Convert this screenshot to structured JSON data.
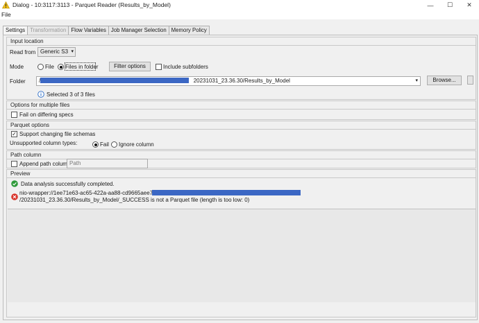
{
  "window": {
    "title": "Dialog - 10:3117:3113 - Parquet Reader (Results_by_Model)",
    "minimize": "—",
    "maximize": "☐",
    "close": "✕"
  },
  "menu": {
    "file": "File"
  },
  "tabs": [
    {
      "label": "Settings",
      "state": "active"
    },
    {
      "label": "Transformation",
      "state": "disabled"
    },
    {
      "label": "Flow Variables",
      "state": "normal"
    },
    {
      "label": "Job Manager Selection",
      "state": "normal"
    },
    {
      "label": "Memory Policy",
      "state": "normal"
    }
  ],
  "input_location": {
    "title": "Input location",
    "read_from_label": "Read from",
    "read_from_value": "Generic S3",
    "mode_label": "Mode",
    "mode_file": "File",
    "mode_folder": "Files in folder",
    "filter_button": "Filter options",
    "include_subfolders": "Include subfolders",
    "folder_label": "Folder",
    "folder_prefix": "/",
    "folder_suffix": "20231031_23.36.30/Results_by_Model",
    "browse_button": "Browse...",
    "selected_info": "Selected 3 of 3 files"
  },
  "multiple_files": {
    "title": "Options for multiple files",
    "fail_on_differing": "Fail on differing specs"
  },
  "parquet_options": {
    "title": "Parquet options",
    "support_changing": "Support changing file schemas",
    "unsupported_label": "Unsupported column types:",
    "opt_fail": "Fail",
    "opt_ignore": "Ignore column"
  },
  "path_column": {
    "title": "Path column",
    "append_label": "Append path column",
    "path_placeholder": "Path"
  },
  "preview": {
    "title": "Preview",
    "success_msg": "Data analysis successfully completed.",
    "error_line1": "nio-wrapper://1ee71e63-ac65-422a-aa88-cd9665aee70f/",
    "error_line2": "/20231031_23.36.30/Results_by_Model/_SUCCESS is not a Parquet file (length is too low: 0)"
  },
  "colors": {
    "redaction": "#3b67c4",
    "success": "#2e9a3a",
    "error": "#d9342b",
    "info": "#2a6cc7"
  }
}
